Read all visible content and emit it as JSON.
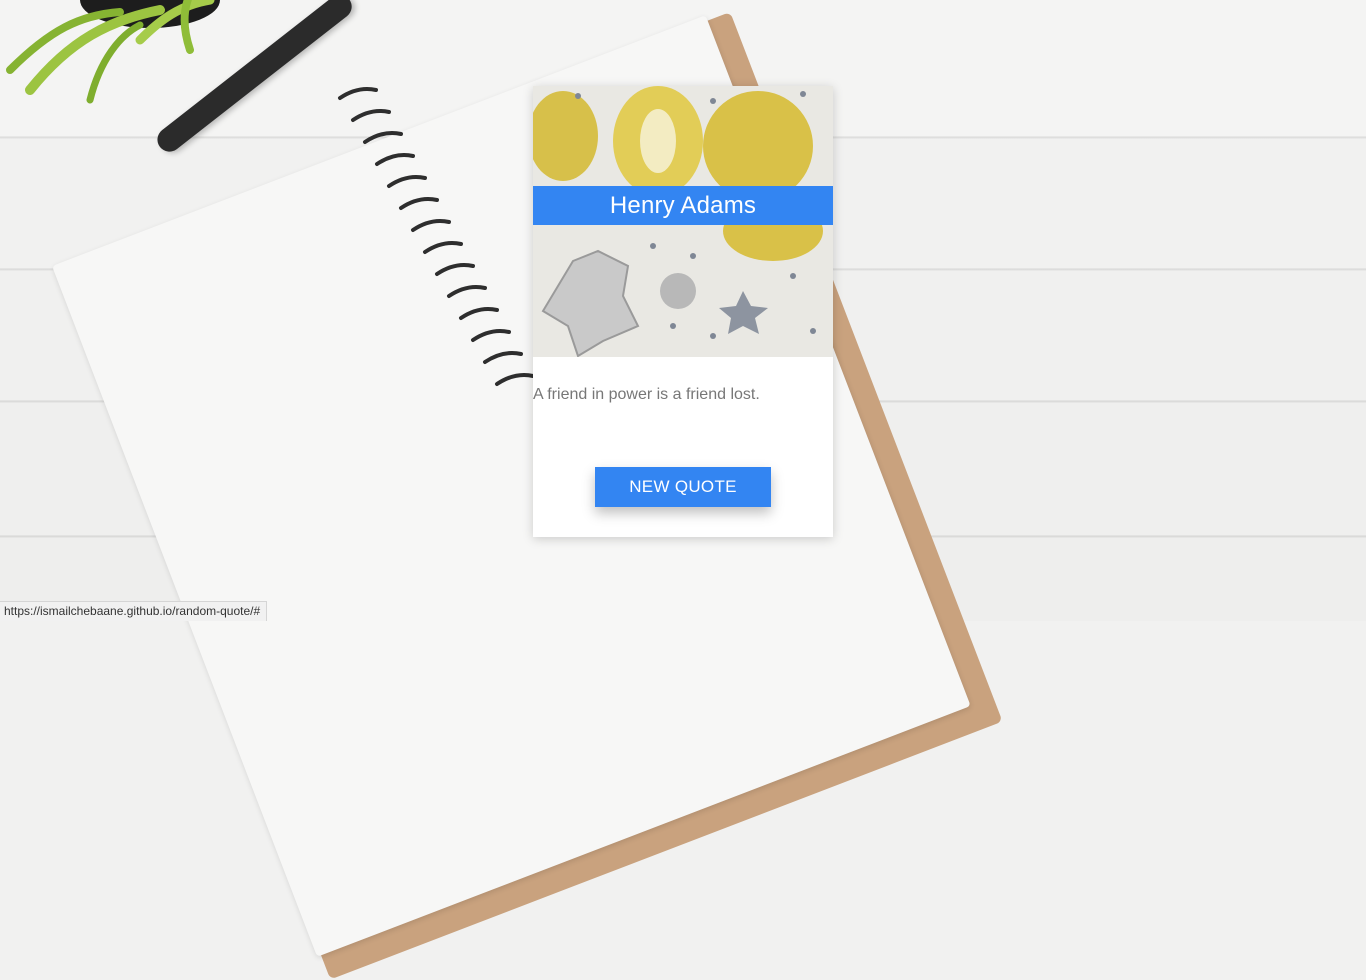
{
  "card": {
    "author": "Henry Adams",
    "quote": "A friend in power is a friend lost.",
    "button_label": "NEW QUOTE"
  },
  "status_bar": {
    "url": "https://ismailchebaane.github.io/random-quote/#"
  },
  "colors": {
    "accent": "#3385f2",
    "quote_text": "#777777"
  }
}
